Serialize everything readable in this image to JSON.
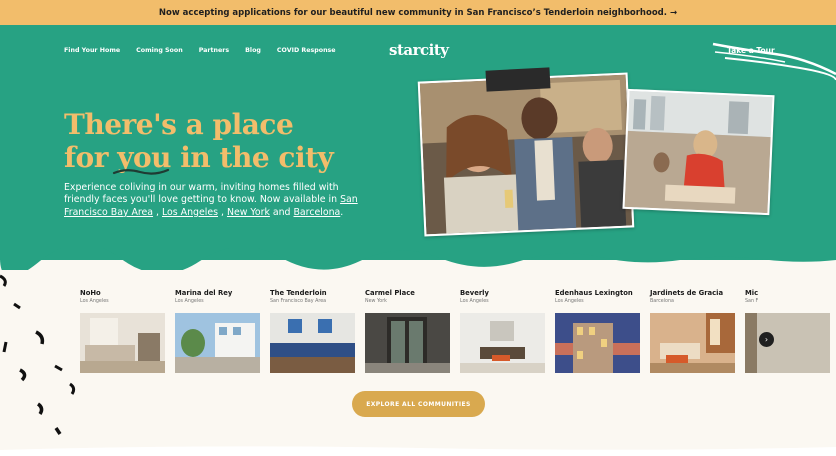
{
  "announcement": "Now accepting applications for our beautiful new community in San Francisco’s Tenderloin neighborhood. →",
  "nav": {
    "items": [
      "Find Your Home",
      "Coming Soon",
      "Partners",
      "Blog",
      "COVID Response"
    ],
    "logo": "starcity",
    "tour": "Take a Tour"
  },
  "hero": {
    "line1": "There's a place",
    "line2_pre": "for ",
    "line2_you": "you",
    "line2_post": " in the city",
    "subtitle": "Experience coliving in our warm, inviting homes filled with friendly faces you'll love getting to know. Now available in",
    "cities": [
      "San Francisco Bay Area",
      "Los Angeles",
      "New York",
      "Barcelona"
    ],
    "sep1": " , ",
    "sep2": " , ",
    "and": " and ",
    "end": "."
  },
  "communities": [
    {
      "name": "NoHo",
      "city": "Los Angeles"
    },
    {
      "name": "Marina del Rey",
      "city": "Los Angeles"
    },
    {
      "name": "The Tenderloin",
      "city": "San Francisco Bay Area"
    },
    {
      "name": "Carmel Place",
      "city": "New York"
    },
    {
      "name": "Beverly",
      "city": "Los Angeles"
    },
    {
      "name": "Edenhaus Lexington",
      "city": "Los Angeles"
    },
    {
      "name": "Jardinets de Gracia",
      "city": "Barcelona"
    },
    {
      "name": "Mic",
      "city": "San F"
    }
  ],
  "explore_label": "EXPLORE ALL COMMUNITIES",
  "colors": {
    "banner": "#f2bd6b",
    "hero": "#27a283",
    "accent": "#f2bd6b",
    "button": "#d9a94f"
  }
}
